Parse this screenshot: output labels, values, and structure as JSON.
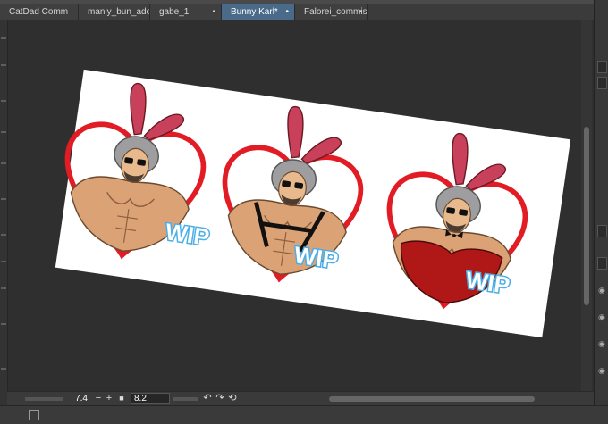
{
  "tabs": [
    {
      "label": "CatDad Comm",
      "active": false
    },
    {
      "label": "manly_bun_adop",
      "active": false
    },
    {
      "label": "gabe_1",
      "active": false
    },
    {
      "label": "Bunny Karl*",
      "active": true
    },
    {
      "label": "Falorei_commissi",
      "active": false
    }
  ],
  "tab_close_glyph": "•",
  "canvas": {
    "watermark": "WIP",
    "stickers": [
      {
        "outfit": "shirtless"
      },
      {
        "outfit": "harness"
      },
      {
        "outfit": "bunny-suit"
      }
    ]
  },
  "statusbar": {
    "zoom_value": "7.4",
    "zoom_minus": "−",
    "zoom_plus": "+",
    "rotation_value": "8.2",
    "rotate_left": "↶",
    "rotate_right": "↷",
    "reset": "⟲"
  },
  "colors": {
    "tab_active": "#4a6a8a",
    "heart": "#e21c24",
    "ears": "#c9405a",
    "wip": "#4aaee8"
  }
}
